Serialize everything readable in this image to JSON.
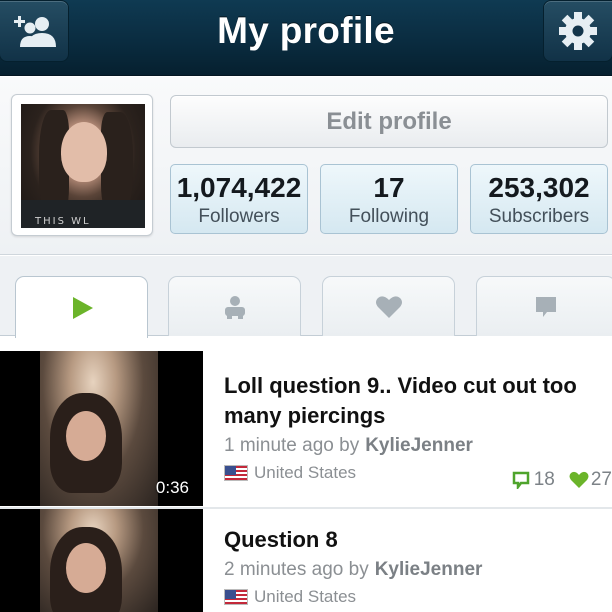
{
  "header": {
    "title": "My profile",
    "left_icon": "add-user-icon",
    "right_icon": "gear-icon"
  },
  "profile": {
    "edit_label": "Edit profile",
    "avatar_shirt_text": "THIS   WL",
    "stats": [
      {
        "value": "1,074,422",
        "label": "Followers"
      },
      {
        "value": "17",
        "label": "Following"
      },
      {
        "value": "253,302",
        "label": "Subscribers"
      }
    ]
  },
  "tabs": [
    {
      "icon": "play-icon",
      "active": true
    },
    {
      "icon": "person-icon",
      "active": false
    },
    {
      "icon": "heart-icon",
      "active": false
    },
    {
      "icon": "comment-icon",
      "active": false
    }
  ],
  "feed": [
    {
      "title_line1": "Loll question 9.. Video cut out too",
      "title_line2": "many piercings",
      "time": "1 minute ago by",
      "author": "KylieJenner",
      "location": "United States",
      "duration": "0:36",
      "comments": "18",
      "likes": "27"
    },
    {
      "title_line1": "Question 8",
      "time": "2 minutes ago by",
      "author": "KylieJenner",
      "location": "United States"
    }
  ],
  "colors": {
    "accent_green": "#6bb42a",
    "topbar": "#0a2c40",
    "stat_bg": "#d5e8f1"
  }
}
